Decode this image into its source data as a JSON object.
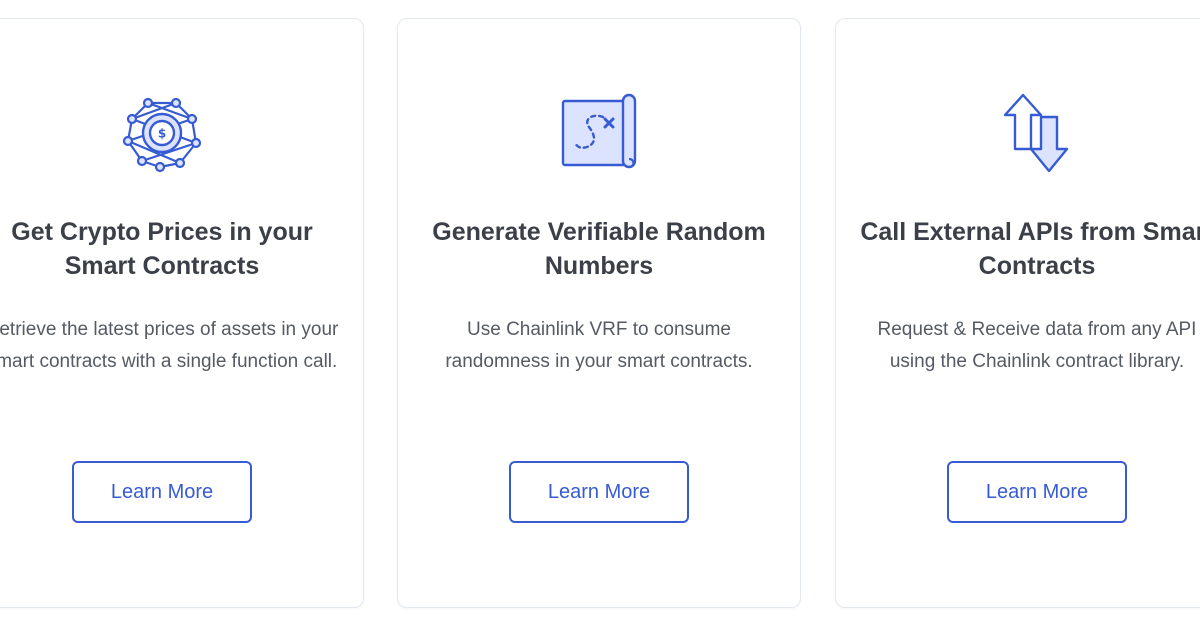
{
  "colors": {
    "accent": "#375bd2",
    "title": "#3b3f47",
    "text": "#555a64",
    "border": "#e3e7ef",
    "icon_fill": "#dbe3ff"
  },
  "cards": [
    {
      "icon": "crypto-network-coin-icon",
      "title": "Get Crypto Prices in your Smart Contracts",
      "description": "Retrieve the latest prices of assets in your smart contracts with a single function call.",
      "button_label": "Learn More"
    },
    {
      "icon": "treasure-map-scroll-icon",
      "title": "Generate Verifiable Random Numbers",
      "description": "Use Chainlink VRF to consume randomness in your smart contracts.",
      "button_label": "Learn More"
    },
    {
      "icon": "swap-arrows-icon",
      "title": "Call External APIs from Smart Contracts",
      "description": "Request & Receive data from any API using the Chainlink contract library.",
      "button_label": "Learn More"
    }
  ]
}
